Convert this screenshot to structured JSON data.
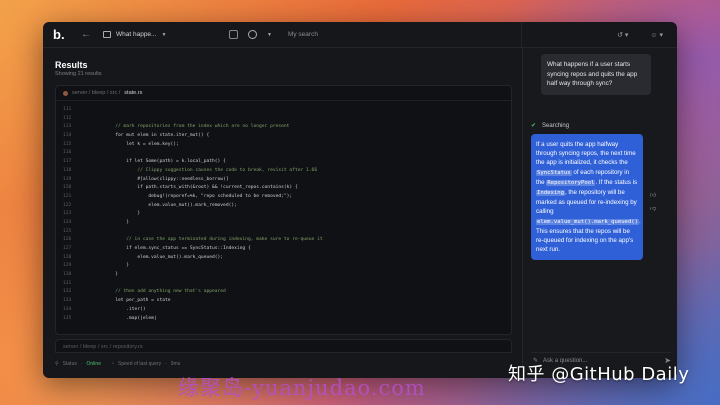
{
  "app": {
    "logo": "b.",
    "project_name": "What happe...",
    "search_placeholder": "My search"
  },
  "results": {
    "title": "Results",
    "subtitle": "Showing 21 results"
  },
  "code_card": {
    "path_prefix": "server / bleep / src /",
    "file": "state.rs",
    "lines": [
      {
        "n": "111",
        "t": ""
      },
      {
        "n": "112",
        "t": ""
      },
      {
        "n": "113",
        "t": "            // mark repositories from the index which are no longer present",
        "c": true
      },
      {
        "n": "114",
        "t": "            for mut elem in state.iter_mut() {"
      },
      {
        "n": "115",
        "t": "                let k = elem.key();"
      },
      {
        "n": "116",
        "t": ""
      },
      {
        "n": "117",
        "t": "                if let Some(path) = k.local_path() {"
      },
      {
        "n": "118",
        "t": "                    // Clippy suggestion causes the code to break, revisit after 1.66",
        "c": true
      },
      {
        "n": "119",
        "t": "                    #[allow(clippy::needless_borrow)]"
      },
      {
        "n": "120",
        "t": "                    if path.starts_with(&root) && !current_repos.contains(k) {"
      },
      {
        "n": "121",
        "t": "                        debug!(reporef=%k, \"repo scheduled to be removed;\");"
      },
      {
        "n": "122",
        "t": "                        elem.value_mut().mark_removed();"
      },
      {
        "n": "123",
        "t": "                    }"
      },
      {
        "n": "124",
        "t": "                }"
      },
      {
        "n": "125",
        "t": ""
      },
      {
        "n": "126",
        "t": "                // in case the app terminated during indexing, make sure to re-queue it",
        "c": true
      },
      {
        "n": "127",
        "t": "                if elem.sync_status == SyncStatus::Indexing {"
      },
      {
        "n": "128",
        "t": "                    elem.value_mut().mark_queued();"
      },
      {
        "n": "129",
        "t": "                }"
      },
      {
        "n": "130",
        "t": "            }"
      },
      {
        "n": "131",
        "t": ""
      },
      {
        "n": "132",
        "t": "            // then add anything new that's appeared",
        "c": true
      },
      {
        "n": "133",
        "t": "            let per_path = state"
      },
      {
        "n": "134",
        "t": "                .iter()"
      },
      {
        "n": "135",
        "t": "                .map(|elem|"
      }
    ]
  },
  "second_card": {
    "path": "server / bleep / src / repository.rs"
  },
  "status": {
    "label": "Status",
    "value": "Online",
    "speed_label": "Speed of last query",
    "speed_value": "9ms"
  },
  "chat": {
    "user_message": "What happens if a user starts syncing repos and quits the app half way through sync?",
    "searching": "Searching",
    "answer": {
      "p1": "If a user quits the app halfway through syncing repos, the next time the app is initialized, it checks the ",
      "code1": "SyncStatus",
      "p2": " of each repository in the ",
      "code2": "RepositoryPool",
      "p3": ". If the status is ",
      "code3": "Indexing",
      "p4": ", the repository will be marked as queued for re-indexing by calling ",
      "code4": "elem.value_mut().mark_queued()",
      "p5": ". This ensures that the repos will be re-queued for indexing on the app's next run."
    },
    "ask_placeholder": "Ask a question..."
  },
  "watermarks": {
    "zhihu": "知乎 @GitHub Daily",
    "site": "缘聚岛-yuanjudao.com"
  },
  "colors": {
    "accent": "#2f60d8",
    "online": "#4fbf6e",
    "window_bg": "#16171a"
  }
}
